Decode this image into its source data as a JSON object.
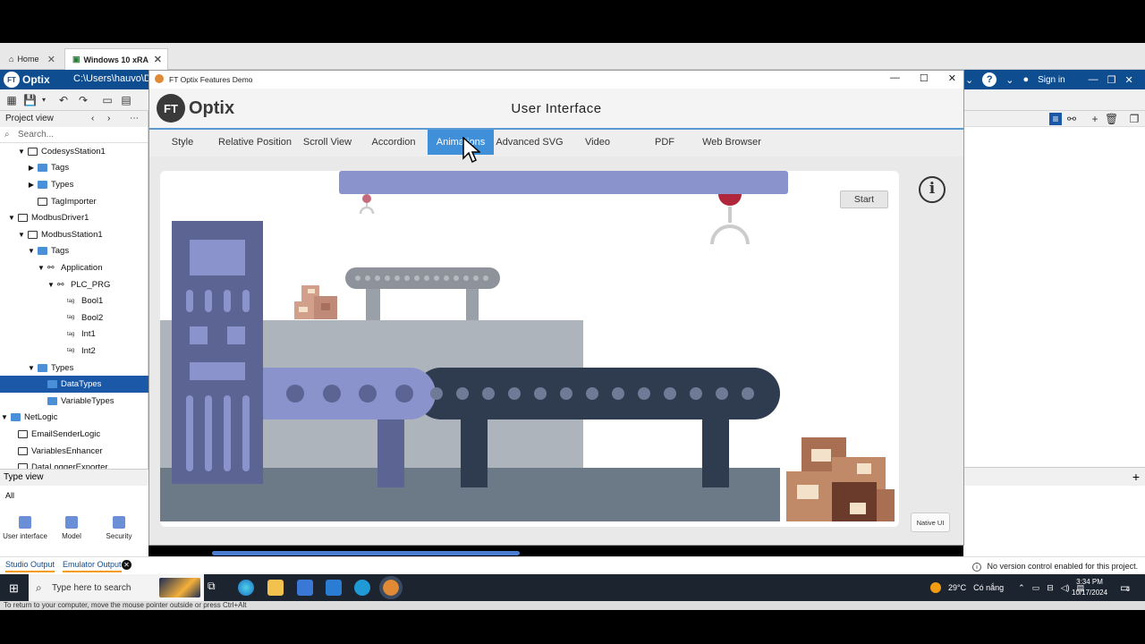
{
  "remote_tabs": [
    {
      "label": "Home"
    },
    {
      "label": "Windows 10 xRA"
    }
  ],
  "studio": {
    "logo_text": "Optix",
    "logo_mark": "FT",
    "path": "C:\\Users\\hauvo\\De",
    "sign_in": "Sign in"
  },
  "project_view": {
    "title": "Project view",
    "search_placeholder": "Search...",
    "tree": [
      {
        "label": "CodesysStation1",
        "icon": "node-icon",
        "twisty": "open",
        "level": 3
      },
      {
        "label": "Tags",
        "icon": "folder-icon",
        "twisty": "closed",
        "level": 4
      },
      {
        "label": "Types",
        "icon": "folder-icon",
        "twisty": "closed",
        "level": 4
      },
      {
        "label": "TagImporter",
        "icon": "node-icon",
        "twisty": "none",
        "level": 4
      },
      {
        "label": "ModbusDriver1",
        "icon": "node-icon",
        "twisty": "open",
        "level": 2
      },
      {
        "label": "ModbusStation1",
        "icon": "node-icon",
        "twisty": "open",
        "level": 3
      },
      {
        "label": "Tags",
        "icon": "folder-icon",
        "twisty": "open",
        "level": 4
      },
      {
        "label": "Application",
        "icon": "hierarchy-icon",
        "twisty": "open",
        "level": 5
      },
      {
        "label": "PLC_PRG",
        "icon": "hierarchy-icon",
        "twisty": "open",
        "level": 6
      },
      {
        "label": "Bool1",
        "icon": "tag-icon",
        "twisty": "none",
        "level": 7
      },
      {
        "label": "Bool2",
        "icon": "tag-icon",
        "twisty": "none",
        "level": 7
      },
      {
        "label": "Int1",
        "icon": "tag-icon",
        "twisty": "none",
        "level": 7
      },
      {
        "label": "Int2",
        "icon": "tag-icon",
        "twisty": "none",
        "level": 7
      },
      {
        "label": "Types",
        "icon": "folder-icon",
        "twisty": "open",
        "level": 4
      },
      {
        "label": "DataTypes",
        "icon": "folder-icon",
        "twisty": "none",
        "level": 5,
        "selected": true
      },
      {
        "label": "VariableTypes",
        "icon": "folder-icon",
        "twisty": "none",
        "level": 5
      },
      {
        "label": "NetLogic",
        "icon": "folder-icon",
        "twisty": "open",
        "level": 1
      },
      {
        "label": "EmailSenderLogic",
        "icon": "node-icon",
        "twisty": "none",
        "level": 2
      },
      {
        "label": "VariablesEnhancer",
        "icon": "node-icon",
        "twisty": "none",
        "level": 2
      },
      {
        "label": "DataLoggerExporter",
        "icon": "node-icon",
        "twisty": "none",
        "level": 2
      }
    ]
  },
  "type_view": {
    "title": "Type view",
    "filter": "All",
    "items": [
      {
        "label": "User interface"
      },
      {
        "label": "Model"
      },
      {
        "label": "Security"
      }
    ]
  },
  "status": {
    "studio_output": "Studio Output",
    "emulator_output": "Emulator Output",
    "version_control": "No version control enabled for this project."
  },
  "app": {
    "window_title": "FT Optix Features Demo",
    "logo_mark": "FT",
    "logo_text": "Optix",
    "page_title": "User Interface",
    "tabs": [
      "Style",
      "Relative Position",
      "Scroll View",
      "Accordion",
      "Animations",
      "Advanced SVG",
      "Video",
      "PDF",
      "Web Browser"
    ],
    "active_tab": "Animations",
    "start_label": "Start",
    "info_glyph": "i",
    "native_ui_label": "Native UI",
    "colors": {
      "accent": "#3f8fd9",
      "machine_dark": "#2f3c4f",
      "machine_blue": "#8b93cc",
      "panel_blue": "#5c6494",
      "box_brown": "#c08a68"
    }
  },
  "taskbar": {
    "search_placeholder": "Type here to search",
    "weather": "29°C",
    "weather_text": "Có nắng",
    "time": "3:34 PM",
    "date": "10/17/2024",
    "notification_count": "6"
  },
  "rd_bottom_text": "To return to your computer, move the mouse pointer outside or press Ctrl+Alt"
}
